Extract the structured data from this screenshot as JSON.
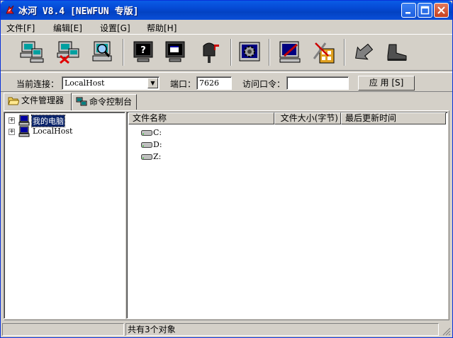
{
  "window": {
    "title": "冰河 V8.4 [NEWFUN 专版]",
    "controls": [
      "minimize",
      "maximize",
      "close"
    ]
  },
  "menu": {
    "items": [
      {
        "label": "文件[F]"
      },
      {
        "label": "编辑[E]"
      },
      {
        "label": "设置[G]"
      },
      {
        "label": "帮助[H]"
      }
    ]
  },
  "toolbar": {
    "buttons": [
      {
        "icon": "add-host-icon"
      },
      {
        "icon": "delete-host-icon"
      },
      {
        "icon": "search-host-icon"
      },
      {
        "icon": "help-monitor-icon"
      },
      {
        "icon": "screen-capture-icon"
      },
      {
        "icon": "mailbox-icon"
      },
      {
        "icon": "settings-gear-icon"
      },
      {
        "icon": "edit-config-icon"
      },
      {
        "icon": "tools-icon"
      },
      {
        "icon": "back-arrow-icon"
      },
      {
        "icon": "boot-exit-icon"
      }
    ]
  },
  "connection": {
    "current_label": "当前连接：",
    "current_value": "LocalHost",
    "port_label": "端口：",
    "port_value": "7626",
    "password_label": "访问口令：",
    "password_value": "",
    "apply_label": "应 用 [S]"
  },
  "tabs": [
    {
      "label": "文件管理器",
      "active": true
    },
    {
      "label": "命令控制台",
      "active": false
    }
  ],
  "tree": {
    "items": [
      {
        "label": "我的电脑",
        "selected": true
      },
      {
        "label": "LocalHost",
        "selected": false
      }
    ]
  },
  "file_list": {
    "columns": [
      "文件名称",
      "文件大小(字节)",
      "最后更新时间"
    ],
    "rows": [
      {
        "name": "C:"
      },
      {
        "name": "D:"
      },
      {
        "name": "Z:"
      }
    ]
  },
  "status": {
    "left": "",
    "right": "共有3个对象"
  },
  "colors": {
    "titlebar": "#0549d4",
    "face": "#d4d0c8",
    "selection": "#0a246a"
  }
}
